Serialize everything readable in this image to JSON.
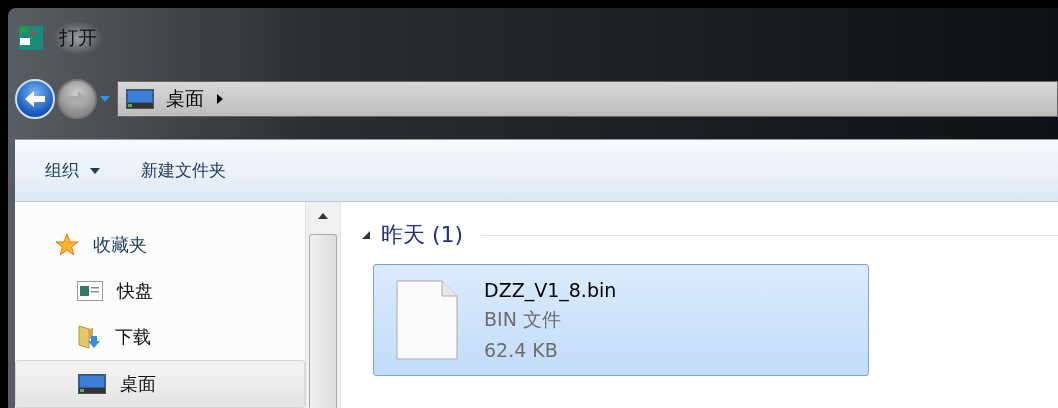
{
  "window": {
    "title": "打开"
  },
  "address_bar": {
    "location": "桌面"
  },
  "toolbar": {
    "items": [
      {
        "label": "组织",
        "kind": "menu"
      },
      {
        "label": "新建文件夹",
        "kind": "button"
      }
    ]
  },
  "sidebar": {
    "items": [
      {
        "label": "收藏夹",
        "kind": "star",
        "selected": false
      },
      {
        "label": "快盘",
        "kind": "window",
        "selected": false
      },
      {
        "label": "下载",
        "kind": "download",
        "selected": false
      },
      {
        "label": "桌面",
        "kind": "desktop",
        "selected": true
      }
    ]
  },
  "groups": [
    {
      "title": "昨天 (1)",
      "expanded": true,
      "files": [
        {
          "name": "DZZ_V1_8.bin",
          "type": "BIN 文件",
          "size": "62.4 KB",
          "selected": true
        }
      ]
    }
  ]
}
